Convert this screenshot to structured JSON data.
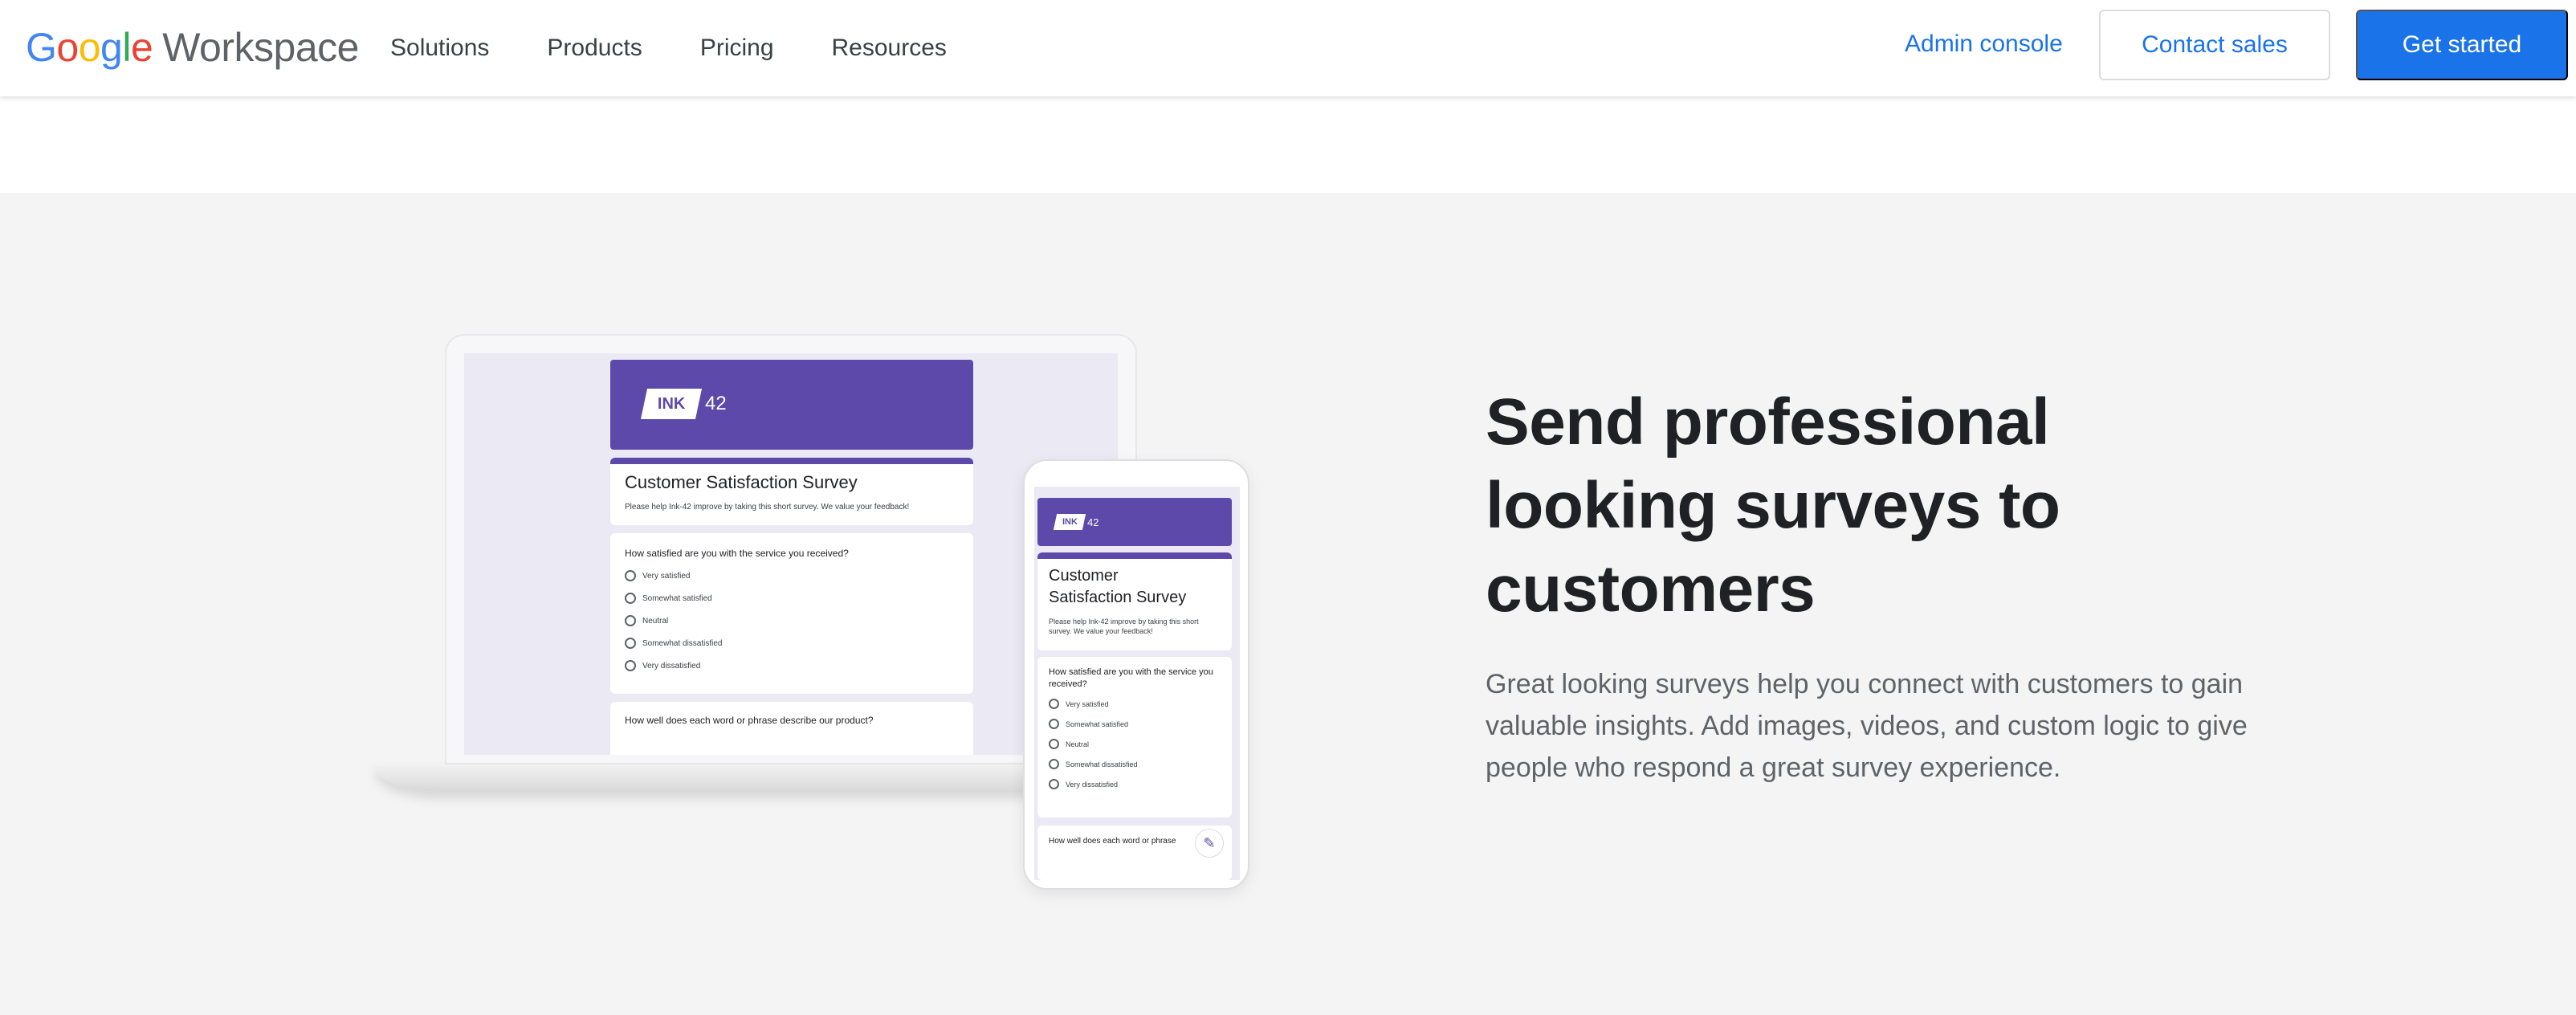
{
  "header": {
    "logo": {
      "google": "Google",
      "product": "Workspace"
    },
    "nav": [
      "Solutions",
      "Products",
      "Pricing",
      "Resources"
    ],
    "admin_console": "Admin console",
    "contact_sales": "Contact sales",
    "get_started": "Get started"
  },
  "colors": {
    "accent": "#1a73e8",
    "form_purple": "#5c49a9",
    "section_bg": "#f4f4f4"
  },
  "hero": {
    "headline_lines": [
      "Send professional",
      "looking surveys to",
      "customers"
    ],
    "body": "Great looking surveys help you connect with customers to gain valuable insights. Add images, videos, and custom logic to give people who respond a great survey experience."
  },
  "laptop_form": {
    "brand_ink": "INK",
    "brand_num": "42",
    "title": "Customer Satisfaction Survey",
    "description": "Please help Ink-42 improve by taking this short survey. We value your feedback!",
    "question1": "How satisfied are you with the service you received?",
    "options": [
      "Very satisfied",
      "Somewhat satisfied",
      "Neutral",
      "Somewhat dissatisfied",
      "Very dissatisfied"
    ],
    "question2": "How well does each word or phrase describe our product?"
  },
  "phone_form": {
    "brand_ink": "INK",
    "brand_num": "42",
    "title_line1": "Customer",
    "title_line2": "Satisfaction Survey",
    "description": "Please help Ink-42 improve by taking this short survey. We value your feedback!",
    "question1": "How satisfied are you with the service you received?",
    "options": [
      "Very satisfied",
      "Somewhat satisfied",
      "Neutral",
      "Somewhat dissatisfied",
      "Very dissatisfied"
    ],
    "question2": "How well does each word or phrase"
  }
}
